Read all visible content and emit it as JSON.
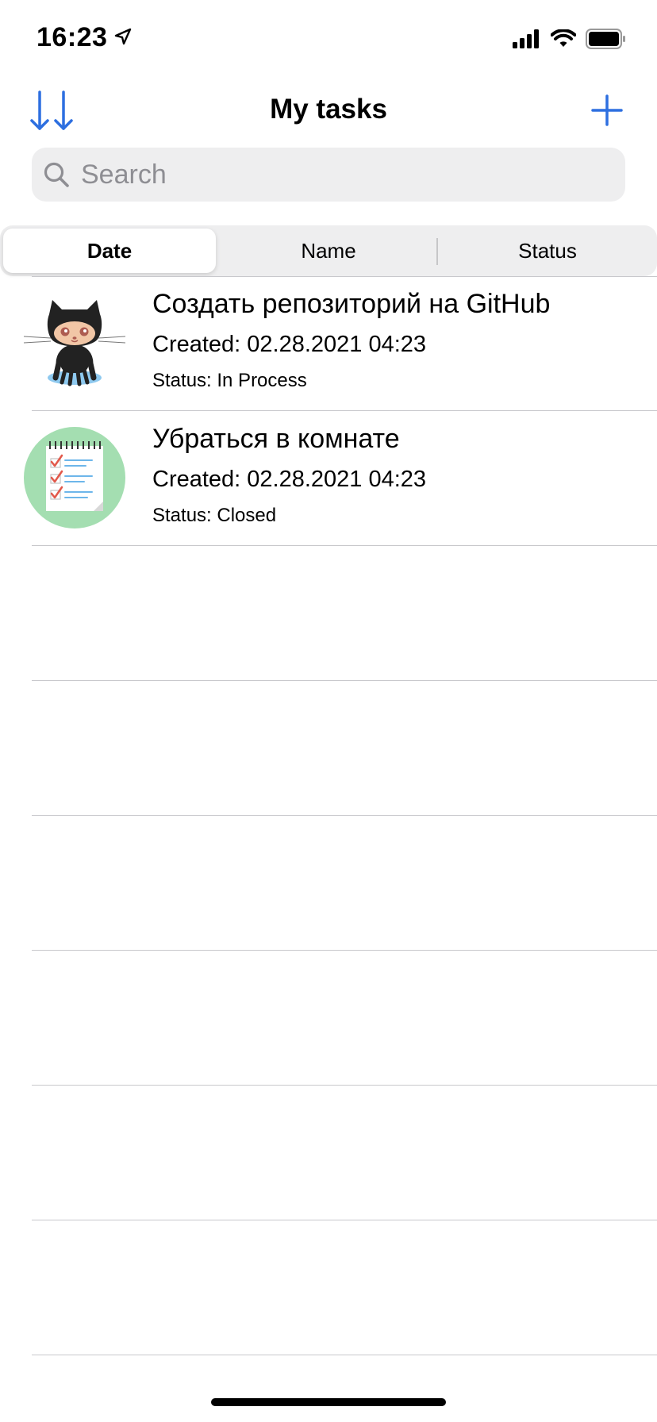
{
  "status_bar": {
    "time": "16:23",
    "icons": [
      "location-arrow-icon",
      "cellular-signal-icon",
      "wifi-icon",
      "battery-icon"
    ]
  },
  "nav": {
    "title": "My tasks",
    "sort_icon": "sort-arrows-icon",
    "add_icon": "plus-icon",
    "accent": "#2d6fe0"
  },
  "search": {
    "placeholder": "Search",
    "value": ""
  },
  "segments": {
    "items": [
      {
        "label": "Date",
        "selected": true
      },
      {
        "label": "Name",
        "selected": false
      },
      {
        "label": "Status",
        "selected": false
      }
    ]
  },
  "tasks": [
    {
      "title": "Создать репозиторий на GitHub",
      "created": "Created: 02.28.2021 04:23",
      "status": "Status: In Process",
      "image": "github-octocat-icon"
    },
    {
      "title": "Убраться в комнате",
      "created": "Created: 02.28.2021 04:23",
      "status": "Status: Closed",
      "image": "checklist-notepad-icon"
    }
  ]
}
